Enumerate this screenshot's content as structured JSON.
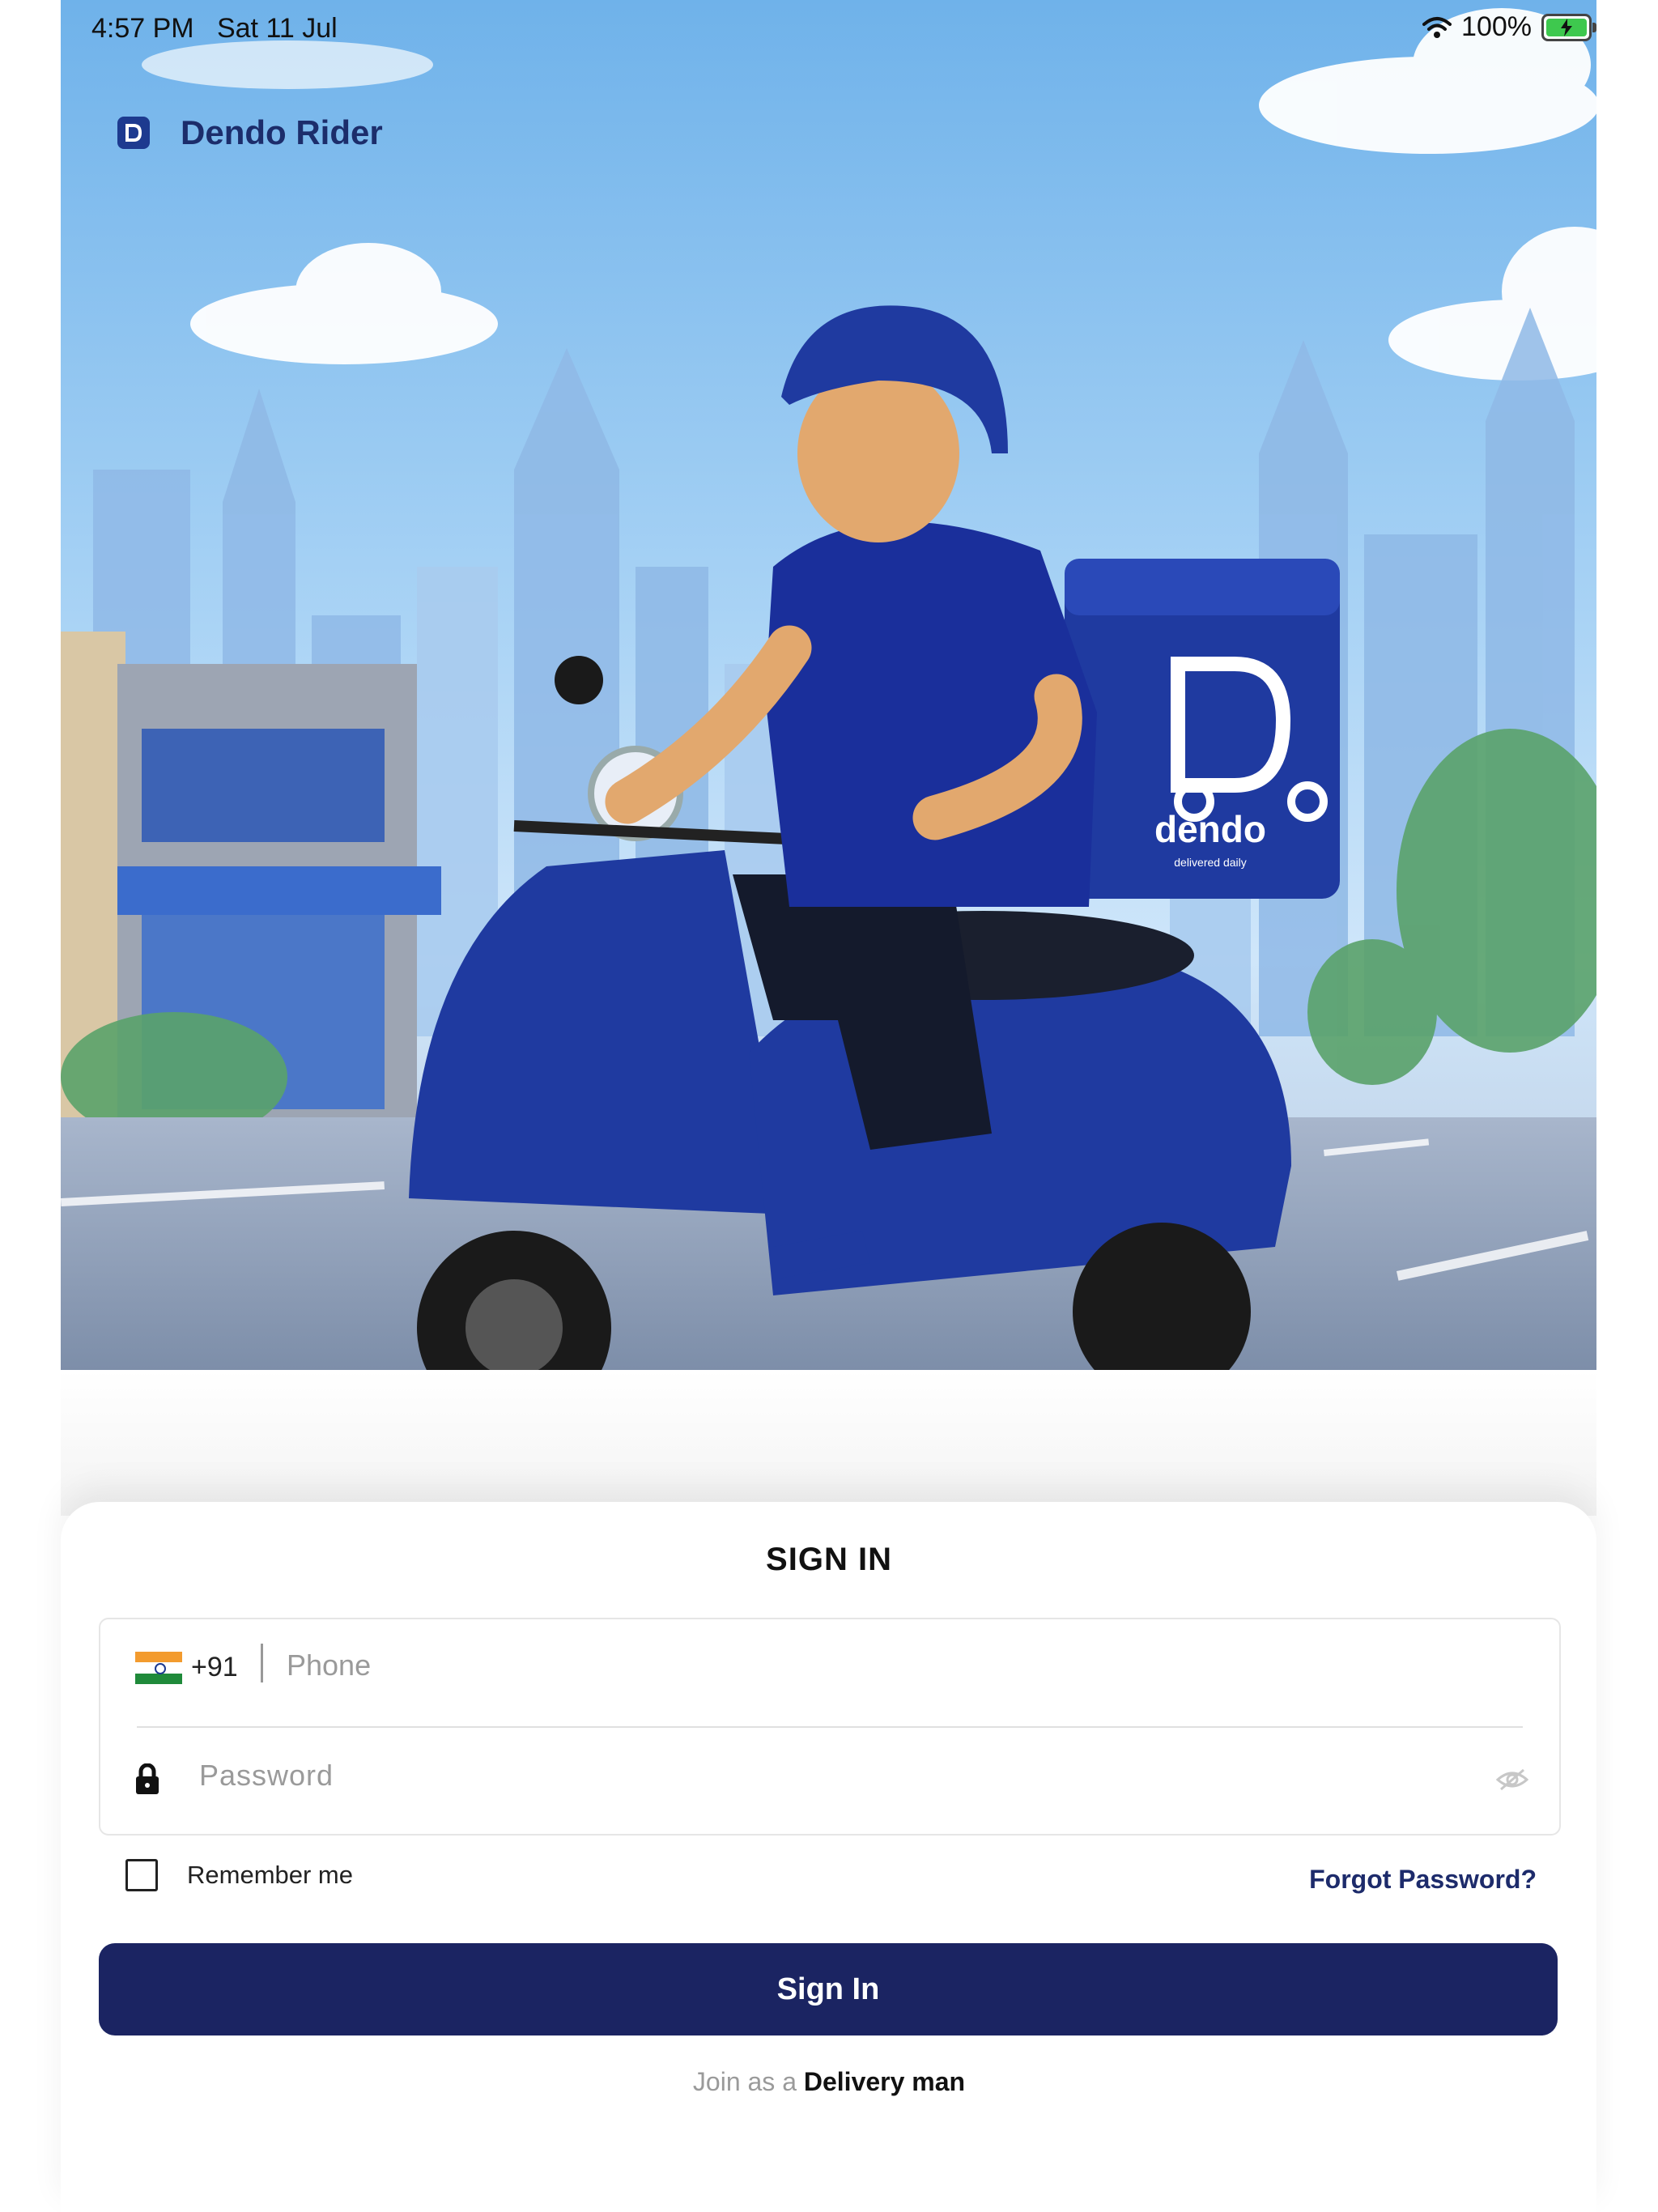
{
  "status_bar": {
    "time": "4:57 PM",
    "date": "Sat 11 Jul",
    "battery": "100%",
    "icons": [
      "wifi-icon",
      "battery-charging-icon"
    ]
  },
  "app": {
    "name": "Dendo Rider",
    "logo_icon": "dendo-logo-icon"
  },
  "hero": {
    "box_brand": "dendo",
    "box_tagline": "delivered daily",
    "colors": {
      "sky": "#8dc3f0",
      "scooter": "#1f3aa0",
      "shirt": "#1a2f9b"
    }
  },
  "signin": {
    "title": "SIGN IN",
    "country_code": "+91",
    "phone_placeholder": "Phone",
    "password_placeholder": "Password",
    "remember_label": "Remember me",
    "forgot_label": "Forgot Password?",
    "button_label": "Sign In",
    "join_prefix": "Join as a",
    "join_link": "Delivery man"
  },
  "colors": {
    "primary": "#1b2462",
    "link": "#1d2b6b",
    "placeholder": "#9a9a9a"
  }
}
